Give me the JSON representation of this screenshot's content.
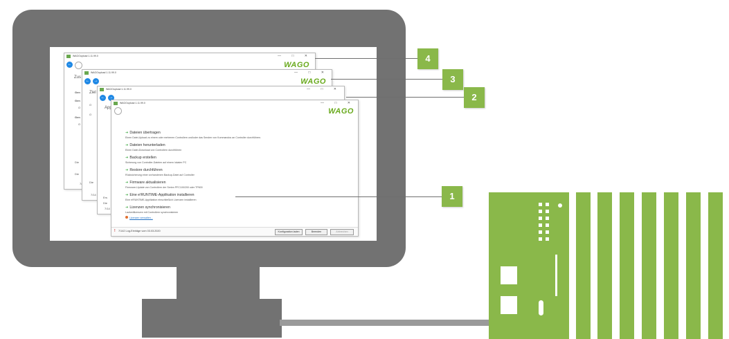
{
  "windows": {
    "w4": {
      "title": "WAGOupload 1.11.99.0",
      "side_text": [
        "Zus",
        "Gen",
        "Gen",
        "O",
        "Gen",
        "O",
        "Die",
        "Die",
        "7/14"
      ]
    },
    "w3": {
      "title": "WAGOupload 1.11.99.0",
      "side_text": [
        "Ziel",
        "O",
        "O",
        "Die",
        "7/14"
      ]
    },
    "w2": {
      "title": "WAGOupload 1.11.99.0",
      "side_text": [
        "App",
        "Ers",
        "Die",
        "7/14"
      ]
    },
    "w1": {
      "title": "WAGOupload 1.11.99.0",
      "window_controls": "— □ ✕",
      "items": [
        {
          "title": "Dateien übertragen",
          "desc": "Einen Datei-Upload zu einem oder mehreren Controllern und/oder das Senden von Kommandos an Controller durchführen."
        },
        {
          "title": "Dateien herunterladen",
          "desc": "Einen Datei-Download von Controllern durchführen"
        },
        {
          "title": "Backup erstellen",
          "desc": "Sicherung von Controller-Dateien auf einem lokalen PC"
        },
        {
          "title": "Restore durchführen",
          "desc": "Rücksicherung einer vorhandenen Backup-Datei auf Controller"
        },
        {
          "title": "Firmware aktualisieren",
          "desc": "Firmware-Update von Controllern der Serien PFC100/200 oder TP600"
        },
        {
          "title": "Eine e!RUNTIME-Applikation installieren",
          "desc": "Eine e!RUNTIME-Applikation einschließlich Lizenzen installieren"
        },
        {
          "title": "Lizenzen synchronisieren",
          "desc": "Laufzeitlizenzen mit Controllern synchronisieren"
        }
      ],
      "link": "Lizenzen verwalten...",
      "footer_status": "7/142 Log-Einträge vom 03.03.2020",
      "buttons": [
        "Konfiguration laden",
        "Beenden",
        "Abbrechen"
      ]
    },
    "logo_text": "WAGO",
    "nav_arrow_glyph": "←",
    "nav_arrow_glyph_2": "→",
    "status_icon_glyph": "!"
  },
  "callouts": [
    "4",
    "3",
    "2",
    "1"
  ],
  "colors": {
    "wago_green": "#8ab84a",
    "monitor_gray": "#727272",
    "cable_gray": "#9a9a9a",
    "arrow_blue": "#1e88e5"
  }
}
